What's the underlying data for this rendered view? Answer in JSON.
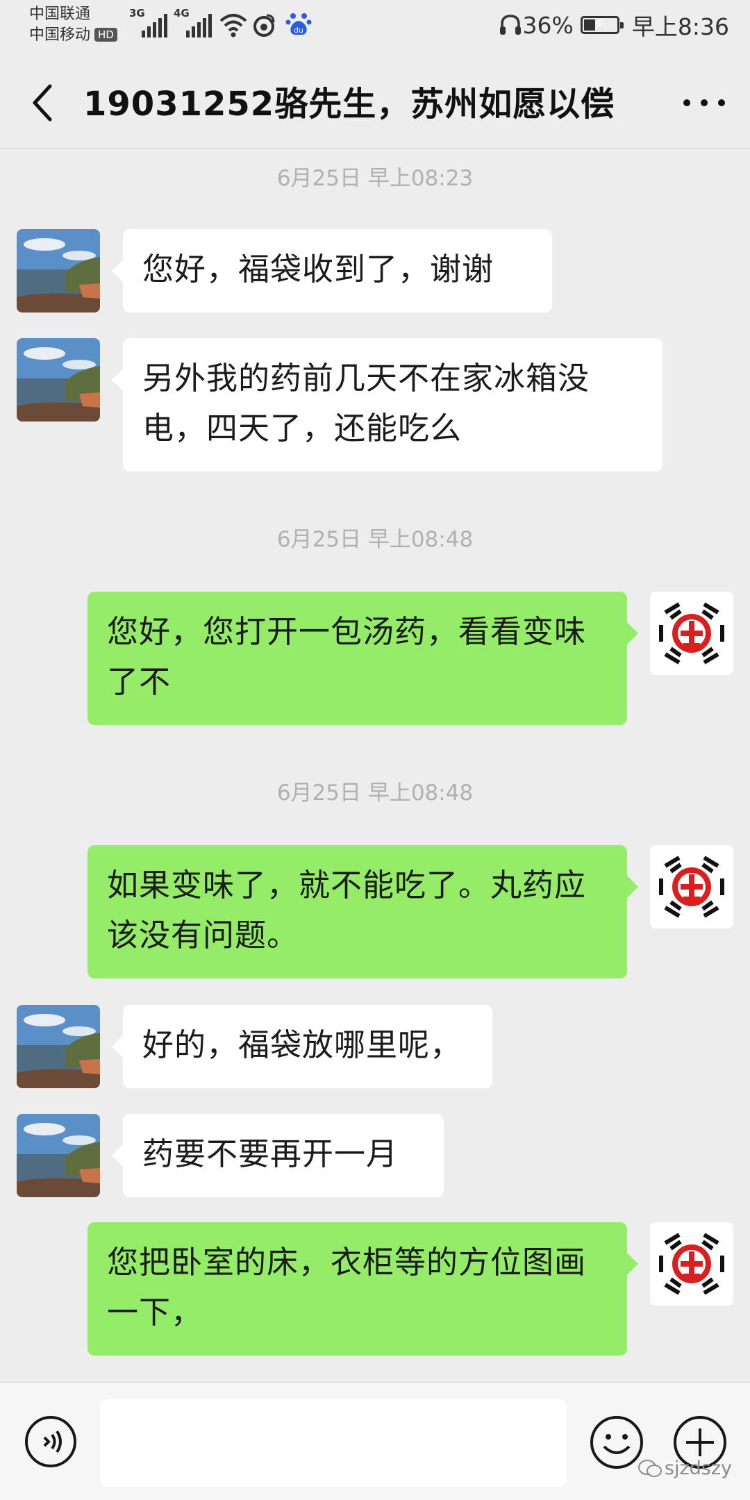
{
  "status_bar": {
    "carrier_1": "中国联通",
    "carrier_2": "中国移动",
    "hd_badge": "HD",
    "network_1": "3G",
    "network_2": "4G",
    "battery_percent": "36%",
    "battery_level": 0.36,
    "time": "早上8:36",
    "icons": [
      "signal-icon",
      "wifi-icon",
      "weibo-icon",
      "baidu-icon",
      "headphones-icon",
      "battery-icon"
    ]
  },
  "header": {
    "title": "19031252骆先生，苏州如愿以偿",
    "back_icon": "chevron-left-icon",
    "more_icon": "more-dots-icon"
  },
  "timestamps": {
    "t1": "6月25日 早上08:23",
    "t2": "6月25日 早上08:48",
    "t3": "6月25日 早上08:48"
  },
  "messages": [
    {
      "from": "friend",
      "text": "您好，福袋收到了，谢谢"
    },
    {
      "from": "friend",
      "text": "另外我的药前几天不在家冰箱没电，四天了，还能吃么"
    },
    {
      "from": "me",
      "text": "您好，您打开一包汤药，看看变味了不"
    },
    {
      "from": "me",
      "text": "如果变味了，就不能吃了。丸药应该没有问题。"
    },
    {
      "from": "friend",
      "text": "好的，福袋放哪里呢，"
    },
    {
      "from": "friend",
      "text": "药要不要再开一月"
    },
    {
      "from": "me",
      "text": "您把卧室的床，衣柜等的方位图画一下，"
    }
  ],
  "input_bar": {
    "value": "",
    "voice_icon": "voice-icon",
    "emoji_icon": "emoji-icon",
    "plus_icon": "plus-icon"
  },
  "watermark": "sjzdszy",
  "colors": {
    "background": "#ededed",
    "my_bubble": "#95ec69",
    "friend_bubble": "#ffffff",
    "timestamp": "#b0b0b0"
  }
}
